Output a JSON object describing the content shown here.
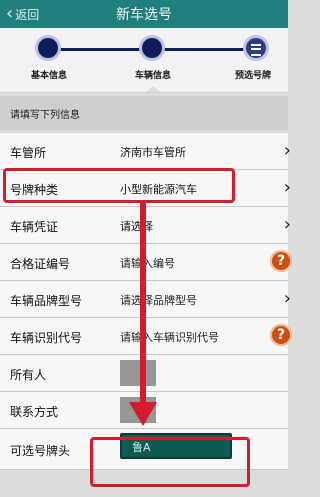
{
  "navbar": {
    "back_label": "返回",
    "title": "新车选号"
  },
  "steps": {
    "items": [
      {
        "label": "基本信息",
        "state": "completed"
      },
      {
        "label": "车辆信息",
        "state": "current"
      },
      {
        "label": "预选号牌",
        "state": "pending"
      }
    ]
  },
  "hint": "请填写下列信息",
  "form": {
    "rows": [
      {
        "label": "车管所",
        "value": "济南市车管所",
        "trailing": "chevron-right-icon"
      },
      {
        "label": "号牌种类",
        "value": "小型新能源汽车",
        "trailing": "chevron-right-icon"
      },
      {
        "label": "车辆凭证",
        "value": "请选择",
        "trailing": "chevron-right-icon"
      },
      {
        "label": "合格证编号",
        "placeholder": "请输入编号",
        "trailing": "help-icon"
      },
      {
        "label": "车辆品牌型号",
        "placeholder": "请选择品牌型号",
        "trailing": "chevron-right-icon"
      },
      {
        "label": "车辆识别代号",
        "placeholder": "请输入车辆识别代号",
        "trailing": "help-icon"
      },
      {
        "label": "所有人",
        "masked": true
      },
      {
        "label": "联系方式",
        "masked": true
      },
      {
        "label": "可选号牌头",
        "select_value": "鲁A"
      }
    ]
  },
  "colors": {
    "navbar": "#1f7f7c",
    "step_active": "#0f1e5a",
    "highlight": "#d51b2c",
    "help": "#d14c12",
    "select_bg": "#0e5b52"
  },
  "icons": {
    "back": "chevron-left-icon",
    "step_done": "check-circle-icon",
    "step_current": "dot-circle-icon",
    "step_next": "list-icon",
    "row_nav": "chevron-right-icon",
    "row_help": "question-mark-icon"
  }
}
